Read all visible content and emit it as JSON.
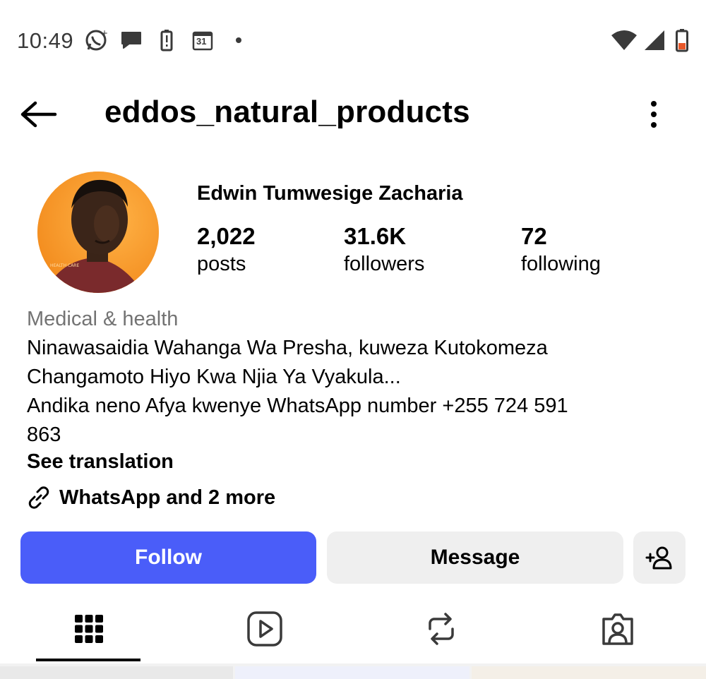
{
  "status_bar": {
    "time": "10:49",
    "icons_left": [
      "whatsapp-icon",
      "chat-bubble-icon",
      "battery-alert-icon",
      "calendar-icon",
      "dot-icon"
    ],
    "calendar_day": "31",
    "icons_right": [
      "wifi-icon",
      "cell-signal-icon",
      "battery-low-icon"
    ]
  },
  "header": {
    "username": "eddos_natural_products"
  },
  "profile": {
    "full_name": "Edwin Tumwesige Zacharia",
    "avatar_caption": "HEALTH CARE",
    "stats": [
      {
        "value": "2,022",
        "label": "posts"
      },
      {
        "value": "31.6K",
        "label": "followers"
      },
      {
        "value": "72",
        "label": "following"
      }
    ],
    "category": "Medical & health",
    "bio_lines": [
      "Ninawasaidia Wahanga Wa Presha,  kuweza Kutokomeza",
      "Changamoto Hiyo Kwa Njia Ya Vyakula...",
      "Andika neno Afya kwenye WhatsApp number +255 724 591",
      "863"
    ],
    "see_translation": "See translation",
    "links_text": "WhatsApp and 2 more"
  },
  "actions": {
    "follow_label": "Follow",
    "message_label": "Message"
  },
  "tabs": [
    "grid-icon",
    "reels-icon",
    "reposts-icon",
    "tagged-icon"
  ],
  "colors": {
    "follow_button": "#4a5df9",
    "secondary_button": "#efefef",
    "category_text": "#737373",
    "avatar_background": "#f7a23a",
    "battery_low": "#e8582a"
  }
}
